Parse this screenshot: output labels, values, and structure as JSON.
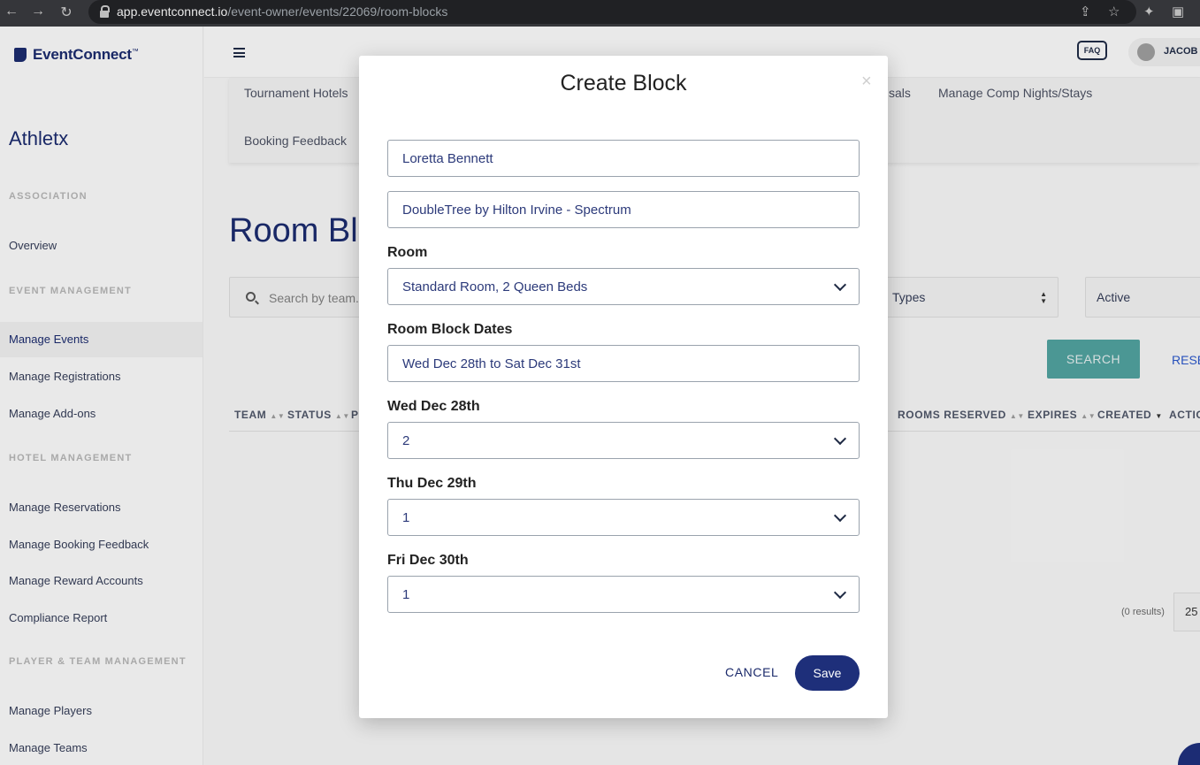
{
  "browser": {
    "url_host": "app.eventconnect.io",
    "url_path": "/event-owner/events/22069/room-blocks"
  },
  "brand": {
    "logo_text": "EventConnect",
    "logo_mark": "™"
  },
  "sidebar": {
    "org_name": "Athletx",
    "sections": [
      {
        "title": "ASSOCIATION",
        "items": [
          "Overview"
        ]
      },
      {
        "title": "EVENT MANAGEMENT",
        "items": [
          "Manage Events",
          "Manage Registrations",
          "Manage Add-ons"
        ]
      },
      {
        "title": "HOTEL MANAGEMENT",
        "items": [
          "Manage Reservations",
          "Manage Booking Feedback",
          "Manage Reward Accounts",
          "Compliance Report"
        ]
      },
      {
        "title": "PLAYER & TEAM MANAGEMENT",
        "items": [
          "Manage Players",
          "Manage Teams"
        ]
      }
    ]
  },
  "topbar": {
    "faq_label": "FAQ",
    "user_name": "JACOB"
  },
  "tabs": {
    "tournament_hotels": "Tournament Hotels",
    "booking_feedback": "Booking Feedback",
    "sals_partial": "sals",
    "comp_nights": "Manage Comp Nights/Stays"
  },
  "page": {
    "title_partial": "Room Blo",
    "search_placeholder": "Search by team...",
    "types_select": "Types",
    "status_select": "Active",
    "search_button": "SEARCH",
    "reset_button": "RESE",
    "columns": [
      "TEAM",
      "STATUS",
      "P",
      "ROOMS RESERVED",
      "EXPIRES",
      "CREATED",
      "ACTIO"
    ],
    "results_text": "(0 results)",
    "per_page": "25"
  },
  "modal": {
    "title": "Create Block",
    "close": "×",
    "team_value": "Loretta Bennett",
    "hotel_value": "DoubleTree by Hilton Irvine - Spectrum",
    "room_label": "Room",
    "room_value": "Standard Room, 2 Queen Beds",
    "dates_label": "Room Block Dates",
    "dates_value": "Wed Dec 28th to Sat Dec 31st",
    "nights": [
      {
        "label": "Wed Dec 28th",
        "value": "2"
      },
      {
        "label": "Thu Dec 29th",
        "value": "1"
      },
      {
        "label": "Fri Dec 30th",
        "value": "1"
      }
    ],
    "cancel_label": "CANCEL",
    "save_label": "Save"
  }
}
